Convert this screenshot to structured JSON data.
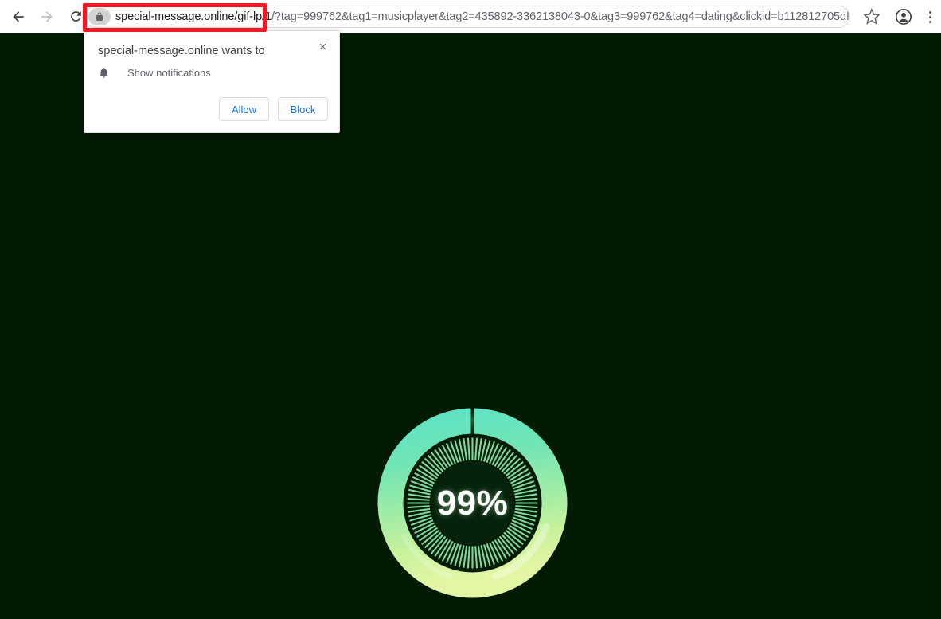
{
  "browser": {
    "back_icon": "arrow-left-icon",
    "forward_icon": "arrow-right-icon",
    "reload_icon": "reload-icon",
    "lock_icon": "lock-icon",
    "url_host": "special-message.online/gif-lp/1",
    "url_query": "/?tag=999762&tag1=musicplayer&tag2=435892-3362138043-0&tag3=999762&tag4=dating&clickid=b112812705df...",
    "url_full": "special-message.online/gif-lp/1/?tag=999762&tag1=musicplayer&tag2=435892-3362138043-0&tag3=999762&tag4=dating&clickid=b112812705df...",
    "bookmark_icon": "star-icon",
    "profile_icon": "account-avatar-icon",
    "menu_icon": "three-dot-menu-icon",
    "highlight_color": "#ed1c24"
  },
  "permission_dialog": {
    "title": "special-message.online wants to",
    "permission_icon": "bell-icon",
    "permission_label": "Show notifications",
    "allow_label": "Allow",
    "block_label": "Block",
    "close_icon": "close-x-icon",
    "link_color": "#1a73e8"
  },
  "page": {
    "background_color": "#031a03",
    "loader": {
      "percent_label": "99%",
      "percent_value": 99,
      "ring_color_start": "#62e0c0",
      "ring_color_mid": "#a8eda0",
      "ring_color_end": "#dcf39a",
      "tick_color": "#7ed9a0",
      "tick_count": 92,
      "text_color": "#ffffff"
    }
  }
}
